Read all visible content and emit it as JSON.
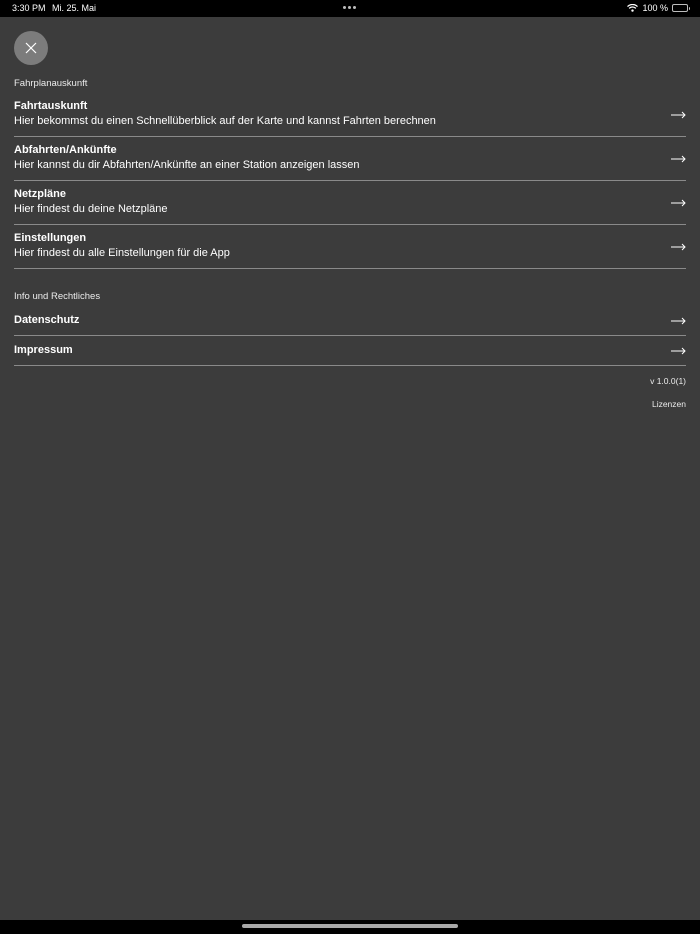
{
  "status_bar": {
    "time": "3:30 PM",
    "date": "Mi. 25. Mai",
    "battery": "100 %",
    "icons": [
      "multitasking-dots-icon",
      "wifi-icon",
      "battery-icon"
    ]
  },
  "close_icon": "close-icon",
  "sections": {
    "timetable": {
      "title": "Fahrplanauskunft",
      "items": [
        {
          "title": "Fahrtauskunft",
          "description": "Hier bekommst du einen Schnellüberblick auf der Karte und kannst Fahrten berechnen"
        },
        {
          "title": "Abfahrten/Ankünfte",
          "description": "Hier kannst du dir Abfahrten/Ankünfte an einer Station anzeigen lassen"
        },
        {
          "title": "Netzpläne",
          "description": "Hier findest du deine Netzpläne"
        },
        {
          "title": "Einstellungen",
          "description": "Hier findest du alle Einstellungen für die App"
        }
      ]
    },
    "legal": {
      "title": "Info und Rechtliches",
      "items": [
        {
          "title": "Datenschutz"
        },
        {
          "title": "Impressum"
        }
      ]
    }
  },
  "footer": {
    "version": "v 1.0.0(1)",
    "licenses": "Lizenzen"
  },
  "colors": {
    "panel_background": "#3c3c3c",
    "status_bar_background": "#000000",
    "divider": "#8a8a8a",
    "close_button": "#7c7c7c",
    "text": "#ffffff"
  }
}
